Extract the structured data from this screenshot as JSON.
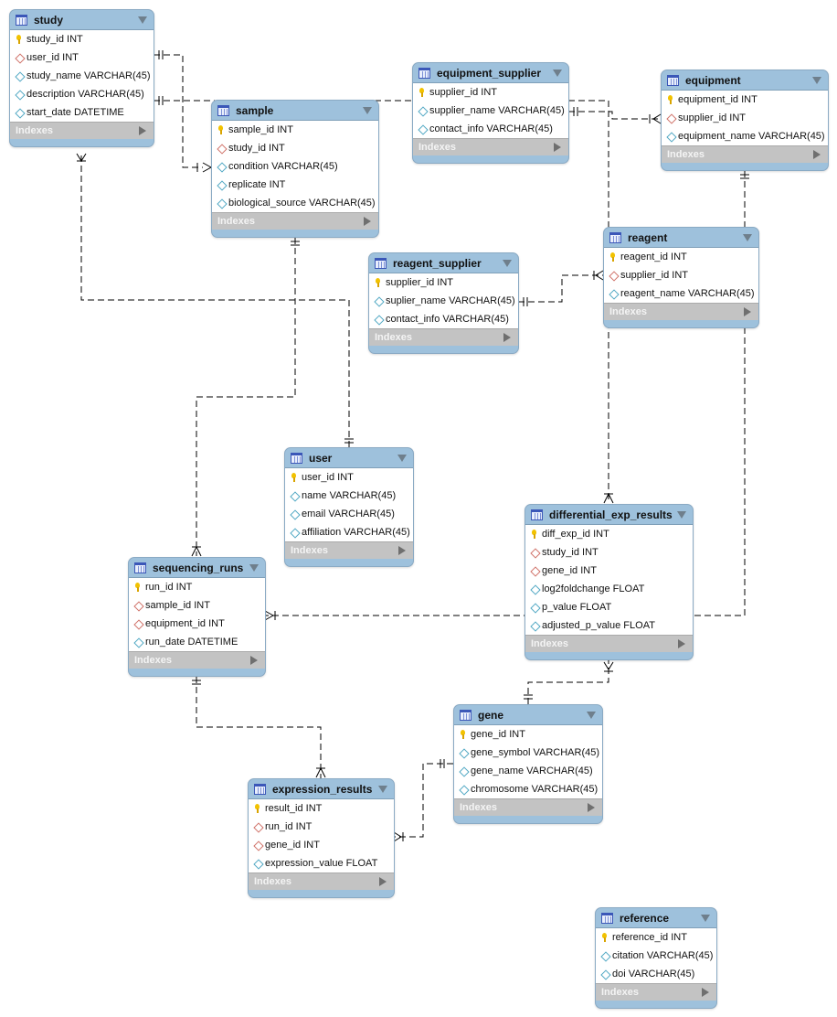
{
  "diagram": {
    "type": "EER diagram",
    "indexes_label": "Indexes",
    "colors": {
      "header": "#9ec1dc",
      "indexes_bar": "#c3c3c3",
      "line": "#000000",
      "primary_key": "#f2c200",
      "foreign_key": "#d0736a",
      "attribute": "#52a9c4"
    }
  },
  "tables": {
    "study": {
      "name": "study",
      "columns": [
        {
          "text": "study_id INT",
          "kind": "pk"
        },
        {
          "text": "user_id INT",
          "kind": "fk"
        },
        {
          "text": "study_name VARCHAR(45)",
          "kind": "att"
        },
        {
          "text": "description VARCHAR(45)",
          "kind": "att"
        },
        {
          "text": "start_date DATETIME",
          "kind": "att"
        }
      ]
    },
    "sample": {
      "name": "sample",
      "columns": [
        {
          "text": "sample_id INT",
          "kind": "pk"
        },
        {
          "text": "study_id INT",
          "kind": "fk"
        },
        {
          "text": "condition VARCHAR(45)",
          "kind": "att"
        },
        {
          "text": "replicate INT",
          "kind": "att"
        },
        {
          "text": "biological_source VARCHAR(45)",
          "kind": "att"
        }
      ]
    },
    "equipment_supplier": {
      "name": "equipment_supplier",
      "columns": [
        {
          "text": "supplier_id INT",
          "kind": "pk"
        },
        {
          "text": "supplier_name VARCHAR(45)",
          "kind": "att"
        },
        {
          "text": "contact_info VARCHAR(45)",
          "kind": "att"
        }
      ]
    },
    "equipment": {
      "name": "equipment",
      "columns": [
        {
          "text": "equipment_id INT",
          "kind": "pk"
        },
        {
          "text": "supplier_id INT",
          "kind": "fk"
        },
        {
          "text": "equipment_name VARCHAR(45)",
          "kind": "att"
        }
      ]
    },
    "reagent_supplier": {
      "name": "reagent_supplier",
      "columns": [
        {
          "text": "supplier_id INT",
          "kind": "pk"
        },
        {
          "text": "suplier_name VARCHAR(45)",
          "kind": "att"
        },
        {
          "text": "contact_info VARCHAR(45)",
          "kind": "att"
        }
      ]
    },
    "reagent": {
      "name": "reagent",
      "columns": [
        {
          "text": "reagent_id INT",
          "kind": "pk"
        },
        {
          "text": "supplier_id INT",
          "kind": "fk"
        },
        {
          "text": "reagent_name VARCHAR(45)",
          "kind": "att"
        }
      ]
    },
    "user": {
      "name": "user",
      "columns": [
        {
          "text": "user_id INT",
          "kind": "pk"
        },
        {
          "text": "name VARCHAR(45)",
          "kind": "att"
        },
        {
          "text": "email VARCHAR(45)",
          "kind": "att"
        },
        {
          "text": "affiliation VARCHAR(45)",
          "kind": "att"
        }
      ]
    },
    "differential_exp_results": {
      "name": "differential_exp_results",
      "columns": [
        {
          "text": "diff_exp_id INT",
          "kind": "pk"
        },
        {
          "text": "study_id INT",
          "kind": "fk"
        },
        {
          "text": "gene_id INT",
          "kind": "fk"
        },
        {
          "text": "log2foldchange FLOAT",
          "kind": "att"
        },
        {
          "text": "p_value FLOAT",
          "kind": "att"
        },
        {
          "text": "adjusted_p_value FLOAT",
          "kind": "att"
        }
      ]
    },
    "sequencing_runs": {
      "name": "sequencing_runs",
      "columns": [
        {
          "text": "run_id INT",
          "kind": "pk"
        },
        {
          "text": "sample_id INT",
          "kind": "fk"
        },
        {
          "text": "equipment_id INT",
          "kind": "fk"
        },
        {
          "text": "run_date DATETIME",
          "kind": "att"
        }
      ]
    },
    "gene": {
      "name": "gene",
      "columns": [
        {
          "text": "gene_id INT",
          "kind": "pk"
        },
        {
          "text": "gene_symbol VARCHAR(45)",
          "kind": "att"
        },
        {
          "text": "gene_name VARCHAR(45)",
          "kind": "att"
        },
        {
          "text": "chromosome VARCHAR(45)",
          "kind": "att"
        }
      ]
    },
    "expression_results": {
      "name": "expression_results",
      "columns": [
        {
          "text": "result_id INT",
          "kind": "pk"
        },
        {
          "text": "run_id INT",
          "kind": "fk"
        },
        {
          "text": "gene_id INT",
          "kind": "fk"
        },
        {
          "text": "expression_value FLOAT",
          "kind": "att"
        }
      ]
    },
    "reference": {
      "name": "reference",
      "columns": [
        {
          "text": "reference_id INT",
          "kind": "pk"
        },
        {
          "text": "citation VARCHAR(45)",
          "kind": "att"
        },
        {
          "text": "doi VARCHAR(45)",
          "kind": "att"
        }
      ]
    }
  },
  "relationships": [
    {
      "from": "study",
      "to": "sample",
      "cardinality": "one-to-many"
    },
    {
      "from": "study",
      "to": "equipment_supplier",
      "cardinality": "one-to-one"
    },
    {
      "from": "user",
      "to": "study",
      "cardinality": "one-to-many"
    },
    {
      "from": "sample",
      "to": "sequencing_runs",
      "cardinality": "one-to-many"
    },
    {
      "from": "equipment_supplier",
      "to": "equipment",
      "cardinality": "one-to-many"
    },
    {
      "from": "equipment_supplier",
      "to": "differential_exp_results",
      "cardinality": "one-to-many"
    },
    {
      "from": "reagent_supplier",
      "to": "reagent",
      "cardinality": "one-to-many"
    },
    {
      "from": "equipment",
      "to": "reagent",
      "cardinality": "one-to-one"
    },
    {
      "from": "reagent",
      "to": "sequencing_runs",
      "cardinality": "one-to-many"
    },
    {
      "from": "sequencing_runs",
      "to": "expression_results",
      "cardinality": "one-to-many"
    },
    {
      "from": "gene",
      "to": "differential_exp_results",
      "cardinality": "one-to-many"
    },
    {
      "from": "gene",
      "to": "expression_results",
      "cardinality": "one-to-many"
    }
  ]
}
